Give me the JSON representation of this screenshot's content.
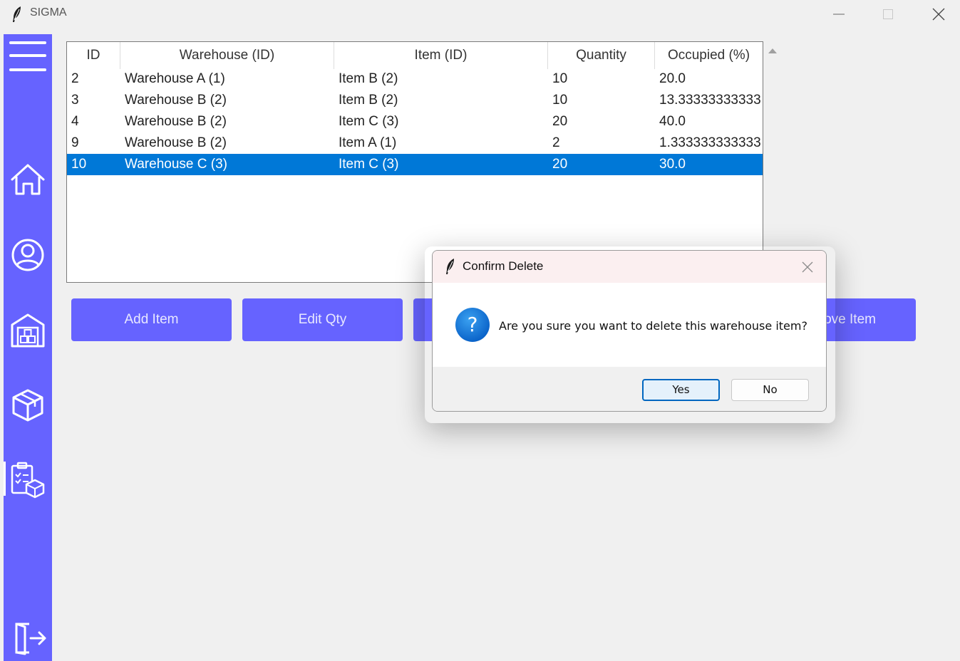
{
  "window": {
    "title": "SIGMA"
  },
  "table": {
    "columns": [
      "ID",
      "Warehouse (ID)",
      "Item (ID)",
      "Quantity",
      "Occupied (%)"
    ],
    "rows": [
      [
        "2",
        "Warehouse A (1)",
        "Item B (2)",
        "10",
        "20.0"
      ],
      [
        "3",
        "Warehouse B (2)",
        "Item B (2)",
        "10",
        "13.33333333333"
      ],
      [
        "4",
        "Warehouse B (2)",
        "Item C (3)",
        "20",
        "40.0"
      ],
      [
        "9",
        "Warehouse B (2)",
        "Item A (1)",
        "2",
        "1.333333333333"
      ],
      [
        "10",
        "Warehouse C (3)",
        "Item C (3)",
        "20",
        "30.0"
      ]
    ],
    "selected_row": 4
  },
  "buttons": {
    "add": "Add Item",
    "edit": "Edit Qty",
    "remove": "Remove Item"
  },
  "dialog": {
    "title": "Confirm Delete",
    "message": "Are you sure you want to delete this warehouse item?",
    "yes": "Yes",
    "no": "No"
  },
  "sidebar": {
    "icons": [
      "menu-icon",
      "home-icon",
      "user-icon",
      "warehouse-icon",
      "box-icon",
      "inventory-report-icon",
      "logout-icon"
    ]
  },
  "colors": {
    "sidebar": "#6663ff",
    "selection": "#0078d7",
    "button": "#6663ff"
  }
}
